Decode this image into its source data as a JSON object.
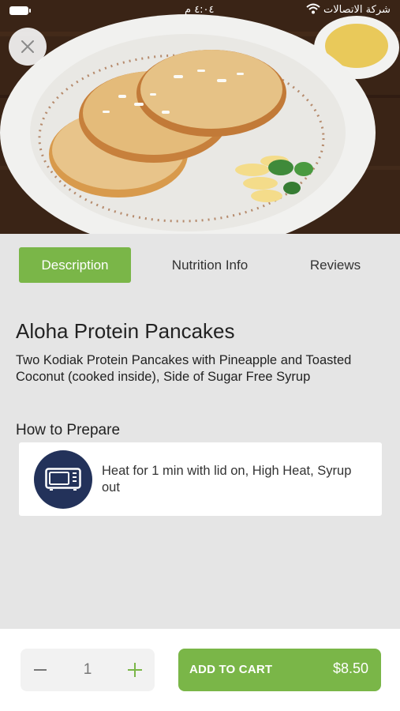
{
  "status_bar": {
    "time": "٤:٠٤ م",
    "carrier": "شركة الاتصالات"
  },
  "hero": {
    "image_alt": "Aloha Protein Pancakes photo"
  },
  "tabs": [
    {
      "label": "Description",
      "active": true
    },
    {
      "label": "Nutrition Info",
      "active": false
    },
    {
      "label": "Reviews",
      "active": false
    }
  ],
  "product": {
    "title": "Aloha Protein Pancakes",
    "description": "Two Kodiak Protein Pancakes with Pineapple and Toasted Coconut (cooked inside), Side of Sugar Free Syrup"
  },
  "how_to_prepare": {
    "heading": "How to Prepare",
    "icon": "microwave-icon",
    "instructions": "Heat for 1 min with lid on, High Heat, Syrup out"
  },
  "cart": {
    "quantity": "1",
    "add_label": "ADD TO CART",
    "price": "$8.50"
  },
  "colors": {
    "accent": "#7ab648",
    "icon_circle": "#23325a",
    "background": "#e5e5e5"
  }
}
